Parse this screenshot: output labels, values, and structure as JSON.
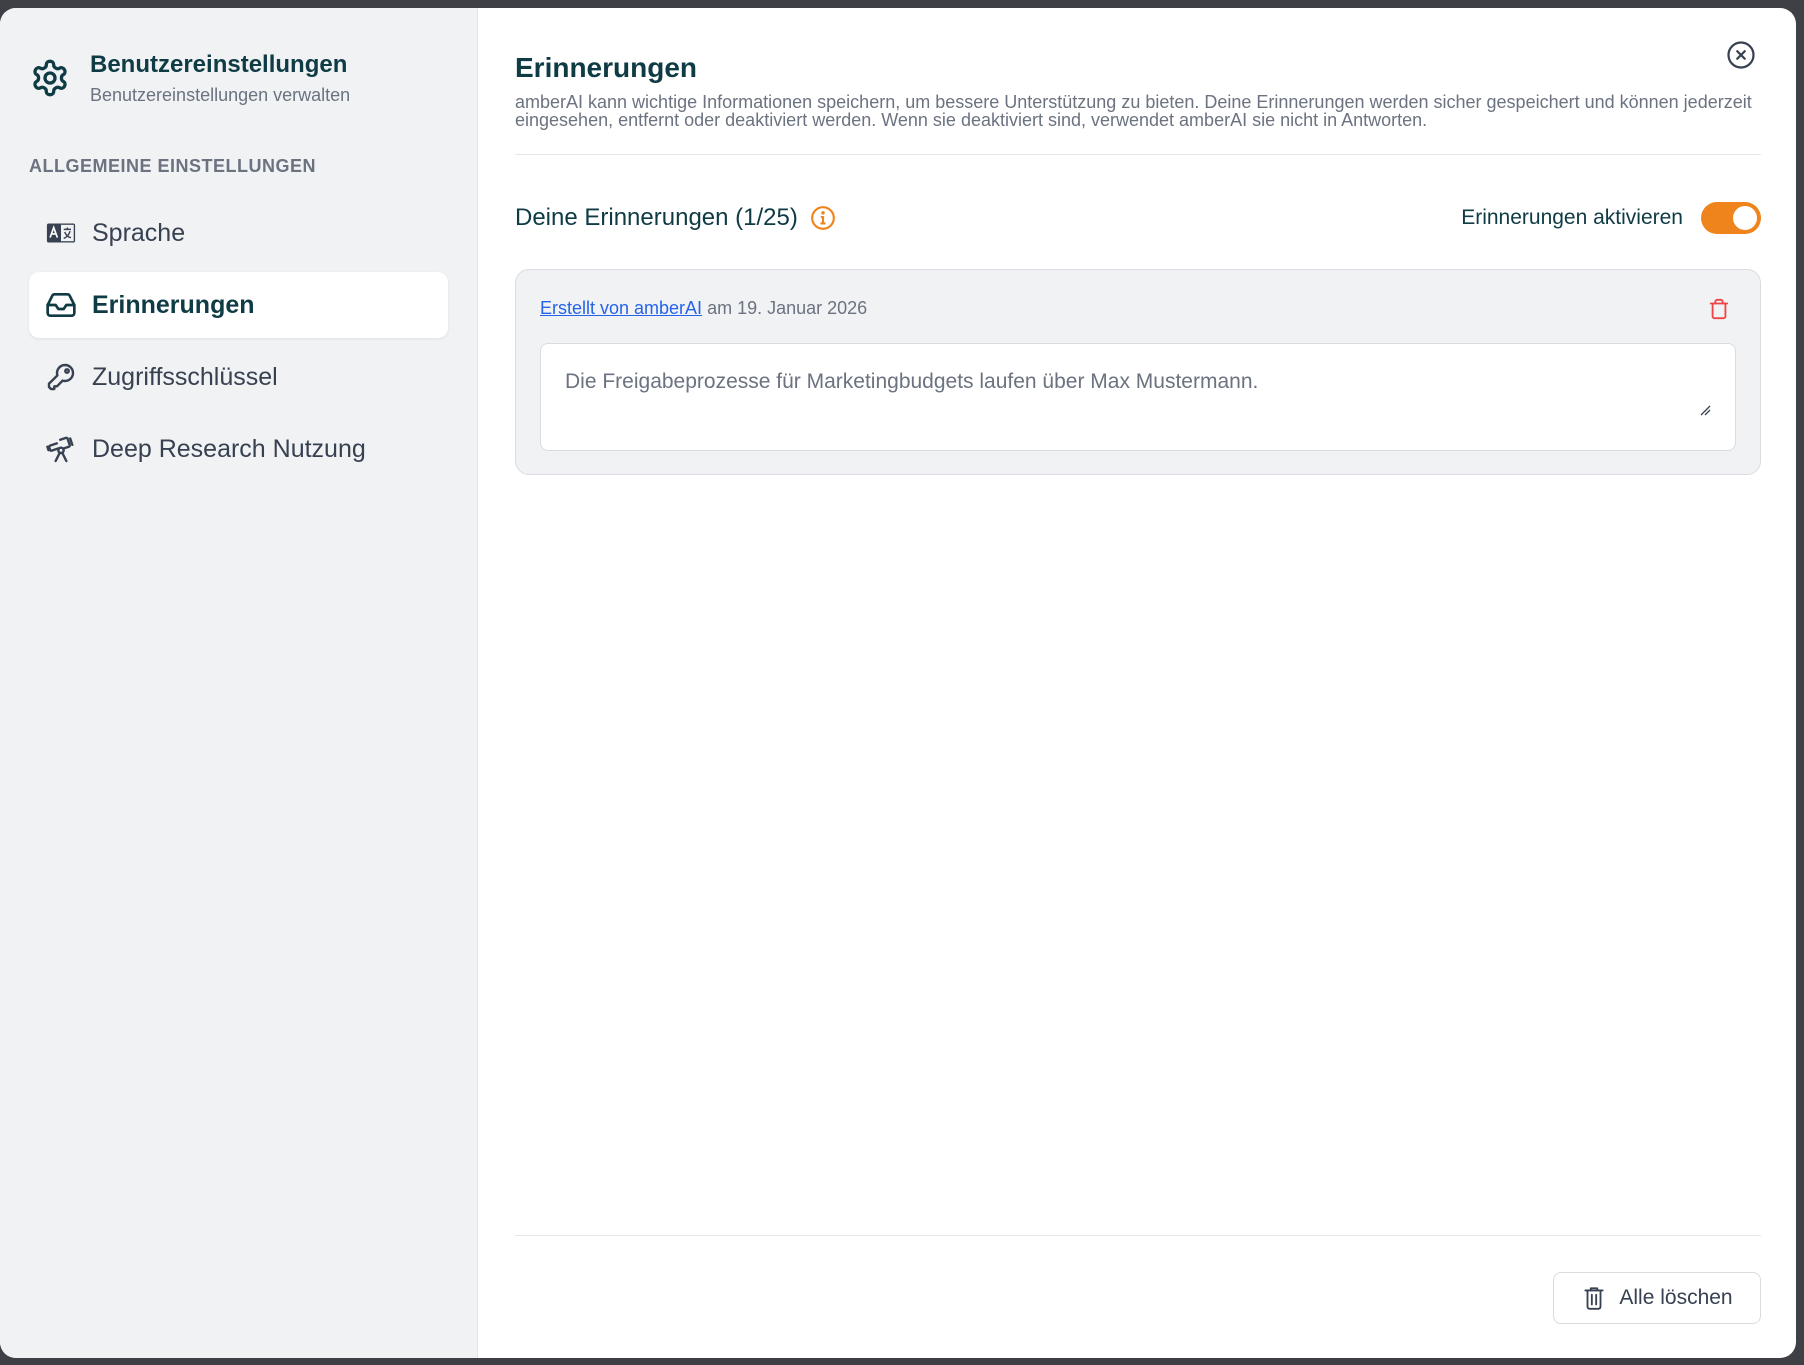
{
  "sidebar": {
    "title": "Benutzereinstellungen",
    "subtitle": "Benutzereinstellungen verwalten",
    "section_label": "ALLGEMEINE EINSTELLUNGEN",
    "items": [
      {
        "label": "Sprache",
        "icon": "language-icon",
        "active": false
      },
      {
        "label": "Erinnerungen",
        "icon": "inbox-icon",
        "active": true
      },
      {
        "label": "Zugriffsschlüssel",
        "icon": "key-icon",
        "active": false
      },
      {
        "label": "Deep Research Nutzung",
        "icon": "telescope-icon",
        "active": false
      }
    ]
  },
  "main": {
    "title": "Erinnerungen",
    "description": "amberAI kann wichtige Informationen speichern, um bessere Unterstützung zu bieten. Deine Erinnerungen werden sicher gespeichert und können jederzeit eingesehen, entfernt oder deaktiviert werden. Wenn sie deaktiviert sind, verwendet amberAI sie nicht in Antworten.",
    "list_title": "Deine Erinnerungen (1/25)",
    "toggle_label": "Erinnerungen aktivieren",
    "toggle_on": true,
    "memories": [
      {
        "creator_link": "Erstellt von amberAI",
        "date_text": "am 19. Januar 2026",
        "text": "Die Freigabeprozesse für Marketingbudgets laufen über Max Mustermann."
      }
    ],
    "delete_all_label": "Alle löschen"
  },
  "colors": {
    "accent": "#f0841c",
    "primary_text": "#0f3b45",
    "link": "#2563eb",
    "danger": "#ef4444"
  }
}
